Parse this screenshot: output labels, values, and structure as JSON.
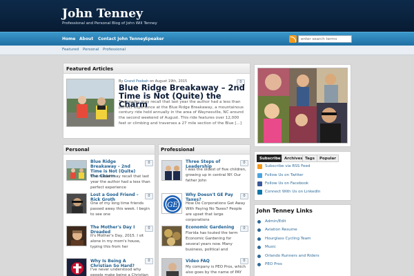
{
  "header": {
    "site_title": "John Tenney",
    "tagline": "Professional and Personal Blog of John Will Tenney"
  },
  "nav": {
    "items": [
      "Home",
      "About",
      "Contact John Tenney",
      "Speaker"
    ],
    "rss_icon": "rss-feed-icon",
    "search_placeholder": "enter search terms"
  },
  "subnav": {
    "items": [
      "Featured",
      "Personal",
      "Professional"
    ]
  },
  "featured": {
    "heading": "Featured Articles",
    "byline_prefix": "By",
    "author": "Grand Poobah",
    "date_text": "on August 19th, 2015",
    "comments": "0",
    "title": "Blue Ridge Breakaway – 2nd Time is Not (Quite) the Charm",
    "excerpt": "The reader may recall that last year the author had a less than perfect experience at the Blue Ridge Breakaway, a mountainous century ride held annually in the area of Waynesville, NC around the second weekend of August. This ride features over 12,000 feet or climbing and traverses a 27 mile section of the Blue [...]"
  },
  "personal": {
    "heading": "Personal",
    "posts": [
      {
        "title": "Blue Ridge Breakaway – 2nd Time is Not (Quite) the Charm",
        "excerpt": "The reader may recall that last year the author had a less than perfect experience",
        "comments": "0"
      },
      {
        "title": "Lost a Good Friend – Rick Groth",
        "excerpt": "One of my long time friends passed away this week. I begin to see one",
        "comments": "0"
      },
      {
        "title": "The Mother's Day I Dreaded",
        "excerpt": "It's Mother's Day, 2015. I sit alone in my mom's house, typing this from her",
        "comments": "0"
      },
      {
        "title": "Why Is Being A Christian So Hard?",
        "excerpt": "I've never understood why people make being a Christian so",
        "comments": "0"
      }
    ]
  },
  "professional": {
    "heading": "Professional",
    "posts": [
      {
        "title": "Three Steps of Leadership",
        "excerpt": "I was the oldest of five children, growing up in central NY. Our father John",
        "comments": "0"
      },
      {
        "title": "Why Doesn't GE Pay Taxes?",
        "excerpt": "How Do Corporations Get Away With Paying No Taxes? People are upset that large corporations",
        "comments": "0"
      },
      {
        "title": "Economic Gardening",
        "excerpt": "Florida has touted the term Economic Gardening for several years now. Many business, political and",
        "comments": "0"
      },
      {
        "title": "Video FAQ",
        "excerpt": "My company is PEO Pros, which also goes by the name of PAY purpose HR. As",
        "comments": "0"
      }
    ]
  },
  "sidebar": {
    "tabs": [
      "Subscribe",
      "Archives",
      "Tags",
      "Popular"
    ],
    "subscribe_links": [
      {
        "label": "Subscribe via RSS Feed",
        "icon": "rss-icon",
        "color": "#f39a1c"
      },
      {
        "label": "Follow Us on Twitter",
        "icon": "twitter-icon",
        "color": "#4aa3df"
      },
      {
        "label": "Follow Us on Facebook",
        "icon": "facebook-icon",
        "color": "#3b5998"
      },
      {
        "label": "Connect With Us on LinkedIn",
        "icon": "linkedin-icon",
        "color": "#0e76a8"
      }
    ],
    "links_heading": "John Tenney Links",
    "links": [
      "Admin/Edit",
      "Aviation Resume",
      "Hourglass Cycling Team",
      "Music",
      "Orlando Runners and Riders",
      "PEO Pros"
    ]
  },
  "colors": {
    "header_bg": "#0b2340",
    "nav_bg": "#2a82b8",
    "link": "#2e6a99",
    "title_dark": "#0a1a35"
  }
}
